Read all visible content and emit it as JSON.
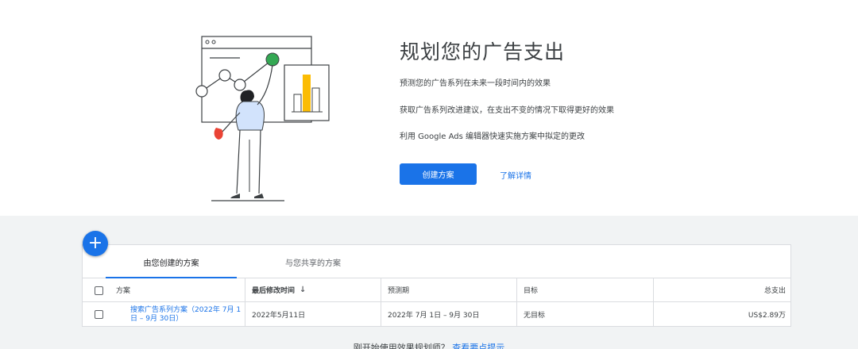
{
  "hero": {
    "title": "规划您的广告支出",
    "bullets": [
      "预测您的广告系列在未来一段时间内的效果",
      "获取广告系列改进建议，在支出不变的情况下取得更好的效果",
      "利用 Google Ads 编辑器快速实施方案中拟定的更改"
    ],
    "create_button": "创建方案",
    "learn_more": "了解详情"
  },
  "fab": {
    "label": "+"
  },
  "tabs": [
    {
      "label": "由您创建的方案",
      "active": true
    },
    {
      "label": "与您共享的方案",
      "active": false
    }
  ],
  "table": {
    "columns": [
      "方案",
      "最后修改时间",
      "预测期",
      "目标",
      "总支出"
    ],
    "sort_icon": "↓",
    "rows": [
      {
        "name": "搜索广告系列方案（2022年 7月 1日 – 9月 30日）",
        "modified": "2022年5月11日",
        "period": "2022年 7月 1日 – 9月 30日",
        "target": "无目标",
        "spend": "US$2.89万"
      }
    ]
  },
  "footer": {
    "text": "刚开始使用效果规划师？",
    "link": "查看要点提示"
  },
  "colors": {
    "accent": "#1a73e8",
    "illustration_green": "#34a853",
    "illustration_yellow": "#fbbc04",
    "illustration_red": "#ea4335"
  }
}
